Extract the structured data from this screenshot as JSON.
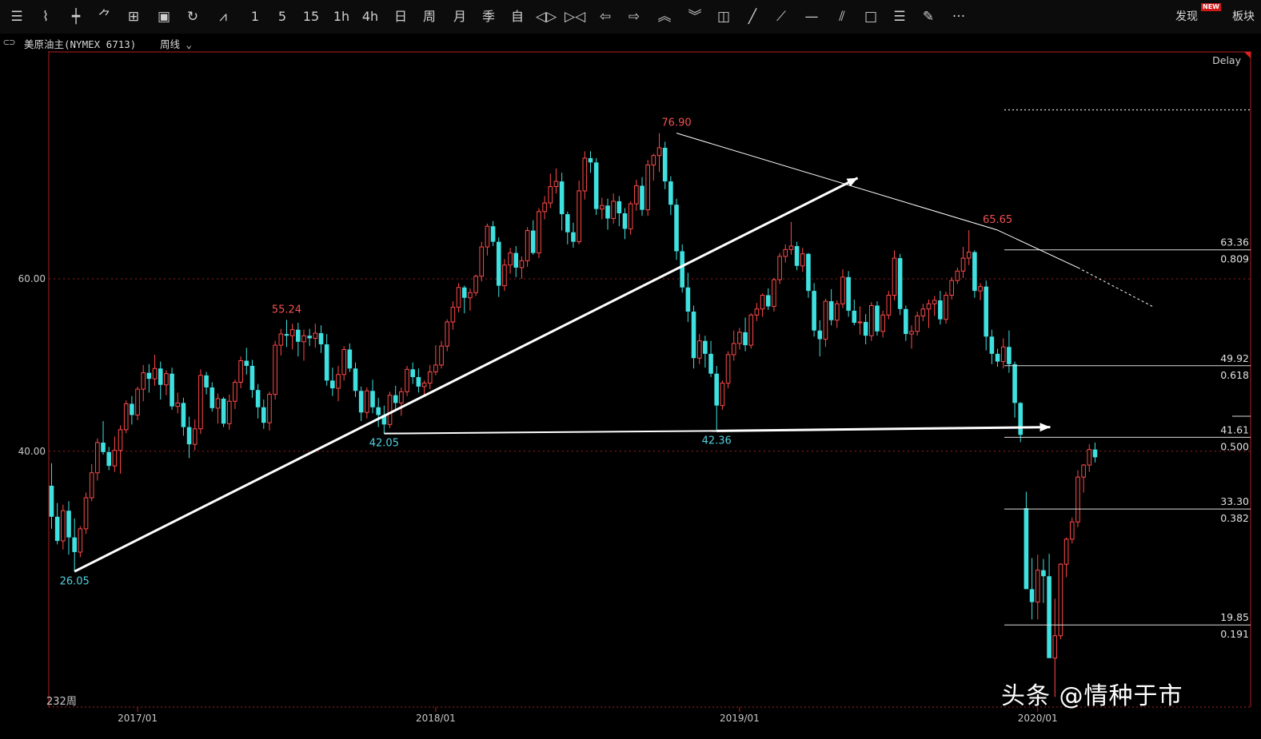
{
  "toolbar": {
    "items": [
      {
        "name": "list-icon",
        "glyph": "☰"
      },
      {
        "name": "line-chart-icon",
        "glyph": "⌇"
      },
      {
        "name": "candle-icon",
        "glyph": "┿"
      },
      {
        "name": "tick-chart-icon",
        "glyph": "⺈"
      },
      {
        "name": "kline-icon",
        "glyph": "⊞"
      },
      {
        "name": "save-icon",
        "glyph": "▣"
      },
      {
        "name": "refresh-icon",
        "glyph": "↻"
      },
      {
        "name": "draw-chart-icon",
        "glyph": "⩘"
      },
      {
        "name": "period-1",
        "label": "1"
      },
      {
        "name": "period-5",
        "label": "5"
      },
      {
        "name": "period-15",
        "label": "15"
      },
      {
        "name": "period-1h",
        "label": "1h"
      },
      {
        "name": "period-4h",
        "label": "4h"
      },
      {
        "name": "period-day",
        "label": "日"
      },
      {
        "name": "period-week",
        "label": "周"
      },
      {
        "name": "period-month",
        "label": "月"
      },
      {
        "name": "period-season",
        "label": "季"
      },
      {
        "name": "period-custom",
        "label": "自"
      },
      {
        "name": "zoom-in-icon",
        "glyph": "◁▷"
      },
      {
        "name": "zoom-out-icon",
        "glyph": "▷◁"
      },
      {
        "name": "left-arrow-icon",
        "glyph": "⇦"
      },
      {
        "name": "right-arrow-icon",
        "glyph": "⇨"
      },
      {
        "name": "up-icon",
        "glyph": "︽"
      },
      {
        "name": "down-icon",
        "glyph": "︾"
      },
      {
        "name": "layout-icon",
        "glyph": "◫"
      },
      {
        "name": "line-tool-icon",
        "glyph": "╱"
      },
      {
        "name": "ray-tool-icon",
        "glyph": "⟋"
      },
      {
        "name": "hline-tool-icon",
        "glyph": "—"
      },
      {
        "name": "channel-tool-icon",
        "glyph": "⫽"
      },
      {
        "name": "rect-tool-icon",
        "glyph": "□"
      },
      {
        "name": "fib-tool-icon",
        "glyph": "☰"
      },
      {
        "name": "pen-tool-icon",
        "glyph": "✎"
      },
      {
        "name": "more-icon",
        "glyph": "···"
      }
    ],
    "discover_label": "发现",
    "new_badge": "NEW",
    "board_label": "板块"
  },
  "info": {
    "symbol": "美原油主(NYMEX 6713)",
    "period": "周线",
    "delay": "Delay",
    "bar_count": "232周"
  },
  "watermark": "头条 @情种于市",
  "colors": {
    "up": "#ff4a4a",
    "down": "#3fe0e0",
    "grid": "#a02020",
    "label_red": "#f25050",
    "label_cyan": "#52d2e0",
    "text": "#c8c8c8"
  },
  "chart_data": {
    "type": "candlestick",
    "ylim": [
      9,
      83
    ],
    "yticks": [
      40,
      60
    ],
    "ytick_labels": [
      "40.00",
      "60.00"
    ],
    "xticks": [
      {
        "label": "2017/01",
        "index": 15
      },
      {
        "label": "2018/01",
        "index": 67
      },
      {
        "label": "2019/01",
        "index": 120
      },
      {
        "label": "2020/01",
        "index": 172
      }
    ],
    "bars": [
      [
        36.0,
        38.6,
        31.0,
        32.4
      ],
      [
        32.4,
        34.0,
        29.2,
        29.6
      ],
      [
        29.6,
        33.8,
        28.6,
        33.1
      ],
      [
        33.1,
        34.2,
        28.0,
        30.0
      ],
      [
        30.0,
        32.2,
        26.05,
        28.3
      ],
      [
        28.3,
        31.3,
        27.7,
        31.0
      ],
      [
        31.0,
        35.2,
        30.4,
        34.6
      ],
      [
        34.6,
        38.5,
        34.2,
        37.5
      ],
      [
        37.5,
        41.5,
        36.6,
        41.0
      ],
      [
        41.0,
        43.5,
        39.6,
        39.9
      ],
      [
        39.9,
        40.5,
        37.8,
        38.3
      ],
      [
        38.3,
        41.7,
        37.6,
        40.1
      ],
      [
        40.1,
        43.0,
        37.4,
        42.5
      ],
      [
        42.5,
        45.9,
        42.1,
        45.5
      ],
      [
        45.5,
        46.4,
        43.1,
        44.2
      ],
      [
        44.2,
        47.5,
        43.6,
        47.2
      ],
      [
        47.2,
        50.0,
        45.8,
        49.1
      ],
      [
        49.1,
        50.1,
        46.8,
        48.4
      ],
      [
        48.4,
        51.2,
        47.6,
        49.6
      ],
      [
        49.6,
        50.4,
        46.0,
        47.7
      ],
      [
        47.7,
        49.4,
        46.5,
        49.0
      ],
      [
        49.0,
        49.7,
        44.8,
        45.2
      ],
      [
        45.2,
        46.8,
        44.4,
        45.6
      ],
      [
        45.6,
        46.2,
        41.8,
        42.8
      ],
      [
        42.8,
        44.0,
        39.2,
        40.8
      ],
      [
        40.8,
        43.7,
        40.1,
        42.6
      ],
      [
        42.6,
        49.5,
        42.0,
        48.8
      ],
      [
        48.8,
        49.2,
        46.6,
        47.4
      ],
      [
        47.4,
        48.0,
        44.6,
        45.0
      ],
      [
        45.0,
        46.7,
        43.2,
        46.1
      ],
      [
        46.1,
        46.3,
        42.8,
        43.2
      ],
      [
        43.2,
        46.6,
        42.5,
        45.8
      ],
      [
        45.8,
        48.3,
        44.9,
        48.0
      ],
      [
        48.0,
        51.0,
        47.3,
        50.5
      ],
      [
        50.5,
        52.0,
        48.9,
        49.9
      ],
      [
        49.9,
        50.6,
        46.2,
        47.1
      ],
      [
        47.1,
        47.8,
        43.8,
        45.1
      ],
      [
        45.1,
        46.0,
        42.6,
        43.3
      ],
      [
        43.3,
        46.9,
        42.4,
        46.6
      ],
      [
        46.6,
        52.8,
        46.0,
        52.3
      ],
      [
        52.3,
        54.2,
        51.1,
        53.6
      ],
      [
        53.6,
        55.24,
        52.1,
        53.4
      ],
      [
        53.4,
        54.8,
        51.8,
        54.1
      ],
      [
        54.1,
        54.9,
        51.0,
        52.7
      ],
      [
        52.7,
        54.1,
        50.5,
        53.4
      ],
      [
        53.4,
        54.2,
        52.2,
        53.1
      ],
      [
        53.1,
        54.8,
        52.0,
        53.7
      ],
      [
        53.7,
        54.6,
        51.4,
        52.4
      ],
      [
        52.4,
        53.6,
        47.6,
        48.2
      ],
      [
        48.2,
        49.7,
        46.4,
        47.3
      ],
      [
        47.3,
        49.9,
        45.8,
        48.9
      ],
      [
        48.9,
        52.2,
        48.2,
        51.8
      ],
      [
        51.8,
        52.5,
        49.2,
        49.6
      ],
      [
        49.6,
        50.3,
        46.3,
        47.0
      ],
      [
        47.0,
        47.5,
        43.5,
        44.5
      ],
      [
        44.5,
        47.4,
        43.8,
        47.0
      ],
      [
        47.0,
        48.3,
        44.4,
        45.1
      ],
      [
        45.1,
        46.2,
        42.8,
        44.2
      ],
      [
        44.2,
        45.3,
        42.05,
        43.1
      ],
      [
        43.1,
        46.9,
        42.7,
        46.5
      ],
      [
        46.5,
        47.6,
        44.9,
        45.6
      ],
      [
        45.6,
        47.4,
        44.1,
        46.9
      ],
      [
        46.9,
        49.9,
        46.4,
        49.5
      ],
      [
        49.5,
        50.3,
        47.8,
        48.6
      ],
      [
        48.6,
        49.6,
        46.8,
        47.5
      ],
      [
        47.5,
        48.2,
        46.3,
        47.9
      ],
      [
        47.9,
        50.0,
        47.2,
        49.2
      ],
      [
        49.2,
        52.3,
        48.8,
        50.0
      ],
      [
        50.0,
        52.8,
        49.6,
        52.2
      ],
      [
        52.2,
        55.3,
        51.6,
        55.0
      ],
      [
        55.0,
        57.4,
        54.1,
        56.7
      ],
      [
        56.7,
        59.5,
        56.1,
        59.0
      ],
      [
        59.0,
        59.2,
        56.0,
        57.8
      ],
      [
        57.8,
        58.9,
        56.3,
        58.4
      ],
      [
        58.4,
        60.5,
        58.0,
        60.3
      ],
      [
        60.3,
        64.3,
        59.7,
        63.7
      ],
      [
        63.7,
        66.4,
        62.7,
        66.1
      ],
      [
        66.1,
        66.7,
        63.8,
        64.3
      ],
      [
        64.3,
        64.8,
        57.9,
        59.2
      ],
      [
        59.2,
        62.3,
        58.6,
        61.6
      ],
      [
        61.6,
        63.6,
        60.6,
        63.0
      ],
      [
        63.0,
        63.8,
        60.2,
        61.3
      ],
      [
        61.3,
        62.6,
        60.0,
        62.1
      ],
      [
        62.1,
        66.0,
        61.4,
        65.6
      ],
      [
        65.6,
        66.8,
        62.8,
        63.0
      ],
      [
        63.0,
        68.2,
        62.4,
        67.8
      ],
      [
        67.8,
        69.6,
        66.9,
        68.8
      ],
      [
        68.8,
        72.2,
        68.2,
        70.7
      ],
      [
        70.7,
        72.8,
        69.9,
        71.3
      ],
      [
        71.3,
        72.3,
        65.6,
        67.5
      ],
      [
        67.5,
        67.8,
        64.0,
        65.4
      ],
      [
        65.4,
        66.5,
        63.6,
        64.3
      ],
      [
        64.3,
        71.4,
        64.0,
        70.2
      ],
      [
        70.2,
        74.8,
        69.2,
        74.0
      ],
      [
        74.0,
        74.8,
        72.3,
        73.5
      ],
      [
        73.5,
        74.0,
        67.4,
        68.1
      ],
      [
        68.1,
        69.4,
        66.9,
        68.5
      ],
      [
        68.5,
        69.3,
        65.7,
        67.0
      ],
      [
        67.0,
        69.9,
        66.4,
        69.0
      ],
      [
        69.0,
        69.6,
        66.1,
        67.6
      ],
      [
        67.6,
        68.2,
        64.6,
        65.8
      ],
      [
        65.8,
        69.0,
        65.1,
        68.7
      ],
      [
        68.7,
        71.5,
        67.9,
        70.8
      ],
      [
        70.8,
        71.8,
        67.3,
        68.0
      ],
      [
        68.0,
        73.8,
        67.3,
        73.2
      ],
      [
        73.2,
        74.5,
        71.4,
        74.3
      ],
      [
        74.3,
        76.9,
        72.4,
        75.2
      ],
      [
        75.2,
        75.9,
        70.4,
        71.3
      ],
      [
        71.3,
        71.9,
        67.4,
        68.6
      ],
      [
        68.6,
        69.3,
        62.2,
        63.2
      ],
      [
        63.2,
        64.0,
        58.4,
        59.0
      ],
      [
        59.0,
        60.7,
        55.0,
        56.2
      ],
      [
        56.2,
        56.9,
        49.6,
        50.8
      ],
      [
        50.8,
        53.6,
        50.1,
        52.8
      ],
      [
        52.8,
        53.4,
        49.7,
        51.3
      ],
      [
        51.3,
        52.8,
        48.6,
        49.0
      ],
      [
        49.0,
        49.9,
        42.36,
        45.3
      ],
      [
        45.3,
        48.2,
        44.8,
        47.9
      ],
      [
        47.9,
        51.6,
        47.3,
        51.2
      ],
      [
        51.2,
        54.0,
        50.5,
        52.5
      ],
      [
        52.5,
        54.3,
        51.8,
        53.8
      ],
      [
        53.8,
        55.5,
        51.6,
        52.3
      ],
      [
        52.3,
        56.0,
        51.9,
        55.8
      ],
      [
        55.8,
        57.2,
        55.1,
        56.5
      ],
      [
        56.5,
        58.3,
        55.6,
        58.1
      ],
      [
        58.1,
        58.9,
        56.4,
        56.8
      ],
      [
        56.8,
        60.1,
        56.2,
        59.9
      ],
      [
        59.9,
        63.0,
        59.4,
        62.6
      ],
      [
        62.6,
        64.0,
        61.9,
        63.4
      ],
      [
        63.4,
        66.6,
        62.8,
        63.8
      ],
      [
        63.8,
        64.3,
        61.0,
        61.5
      ],
      [
        61.5,
        63.6,
        60.8,
        62.9
      ],
      [
        62.9,
        63.0,
        57.8,
        58.6
      ],
      [
        58.6,
        59.5,
        53.3,
        54.0
      ],
      [
        54.0,
        55.2,
        51.0,
        53.0
      ],
      [
        53.0,
        57.7,
        52.1,
        57.4
      ],
      [
        57.4,
        58.8,
        54.6,
        55.2
      ],
      [
        55.2,
        57.5,
        54.3,
        57.1
      ],
      [
        57.1,
        61.1,
        56.6,
        60.2
      ],
      [
        60.2,
        60.9,
        55.6,
        56.3
      ],
      [
        56.3,
        57.6,
        54.6,
        54.9
      ],
      [
        54.9,
        56.8,
        53.5,
        55.0
      ],
      [
        55.0,
        55.9,
        52.4,
        53.4
      ],
      [
        53.4,
        57.3,
        52.8,
        56.9
      ],
      [
        56.9,
        57.4,
        53.4,
        53.9
      ],
      [
        53.9,
        56.3,
        53.2,
        55.8
      ],
      [
        55.8,
        58.6,
        55.3,
        58.1
      ],
      [
        58.1,
        63.3,
        57.5,
        62.4
      ],
      [
        62.4,
        62.9,
        55.8,
        56.5
      ],
      [
        56.5,
        56.9,
        52.8,
        53.6
      ],
      [
        53.6,
        54.6,
        51.9,
        53.9
      ],
      [
        53.9,
        56.2,
        53.4,
        55.7
      ],
      [
        55.7,
        57.1,
        55.1,
        56.5
      ],
      [
        56.5,
        57.6,
        54.3,
        57.1
      ],
      [
        57.1,
        58.0,
        55.7,
        57.5
      ],
      [
        57.5,
        58.6,
        54.7,
        55.3
      ],
      [
        55.3,
        58.5,
        54.8,
        58.1
      ],
      [
        58.1,
        60.2,
        57.6,
        59.8
      ],
      [
        59.8,
        61.3,
        59.4,
        60.9
      ],
      [
        60.9,
        63.7,
        60.1,
        62.4
      ],
      [
        62.4,
        65.65,
        61.6,
        63.1
      ],
      [
        63.1,
        63.3,
        57.8,
        58.6
      ],
      [
        58.6,
        59.5,
        57.5,
        59.1
      ],
      [
        59.1,
        59.8,
        51.7,
        53.3
      ],
      [
        53.3,
        54.1,
        50.1,
        51.3
      ],
      [
        51.3,
        51.9,
        49.8,
        50.4
      ],
      [
        50.4,
        53.1,
        49.6,
        52.1
      ],
      [
        52.1,
        54.0,
        49.1,
        50.1
      ],
      [
        50.1,
        50.4,
        43.9,
        45.6
      ],
      [
        45.6,
        45.7,
        41.05,
        41.9
      ],
      [
        33.4,
        35.3,
        24.6,
        24.0
      ],
      [
        24.0,
        27.6,
        20.5,
        22.5
      ],
      [
        22.5,
        28.0,
        20.5,
        26.2
      ],
      [
        26.2,
        27.5,
        22.4,
        25.5
      ],
      [
        25.5,
        28.1,
        19.5,
        16.0
      ],
      [
        16.0,
        22.9,
        11.5,
        18.6
      ],
      [
        18.6,
        27.0,
        18.2,
        26.9
      ],
      [
        26.9,
        30.0,
        25.4,
        29.8
      ],
      [
        29.8,
        32.3,
        29.3,
        31.8
      ],
      [
        31.8,
        37.8,
        31.2,
        37.0
      ],
      [
        37.0,
        38.5,
        35.2,
        38.4
      ],
      [
        38.4,
        40.8,
        37.6,
        40.2
      ],
      [
        40.2,
        41.0,
        38.7,
        39.3
      ]
    ],
    "price_labels": [
      {
        "text": "26.05",
        "index": 4,
        "value": 26.05,
        "color": "cyan",
        "pos": "below"
      },
      {
        "text": "55.24",
        "index": 41,
        "value": 55.24,
        "color": "red",
        "pos": "above"
      },
      {
        "text": "42.05",
        "index": 58,
        "value": 42.05,
        "color": "cyan",
        "pos": "below"
      },
      {
        "text": "76.90",
        "index": 109,
        "value": 76.9,
        "color": "red",
        "pos": "above"
      },
      {
        "text": "42.36",
        "index": 116,
        "value": 42.36,
        "color": "cyan",
        "pos": "below"
      },
      {
        "text": "65.65",
        "index": 165,
        "value": 65.65,
        "color": "red",
        "pos": "above"
      }
    ],
    "fib_levels": [
      {
        "price": "63.36",
        "ratio": "0.809",
        "value": 63.36
      },
      {
        "price": "49.92",
        "ratio": "0.618",
        "value": 49.92
      },
      {
        "price": "41.61",
        "ratio": "0.500",
        "value": 41.61
      },
      {
        "price": "33.30",
        "ratio": "0.382",
        "value": 33.3
      },
      {
        "price": "19.85",
        "ratio": "0.191",
        "value": 19.85
      }
    ],
    "top_dotted_value": 79.6,
    "lines": [
      {
        "from": [
          4,
          26.05
        ],
        "to": [
          140.6,
          71.7
        ],
        "arrow": true,
        "width": 3
      },
      {
        "from": [
          58,
          42.05
        ],
        "to": [
          116,
          42.36
        ],
        "arrow": false,
        "width": 2
      },
      {
        "from": [
          116,
          42.36
        ],
        "to": [
          174.2,
          42.8
        ],
        "arrow": true,
        "width": 3
      },
      {
        "from": [
          109,
          76.9
        ],
        "to": [
          165,
          65.65
        ],
        "arrow": false,
        "width": 1
      },
      {
        "from": [
          165,
          65.65
        ],
        "to": [
          179,
          61.3
        ],
        "arrow": false,
        "width": 1
      },
      {
        "from": [
          179,
          61.3
        ],
        "to": [
          192,
          56.8
        ],
        "arrow": false,
        "width": 1,
        "dashed": true
      }
    ]
  }
}
